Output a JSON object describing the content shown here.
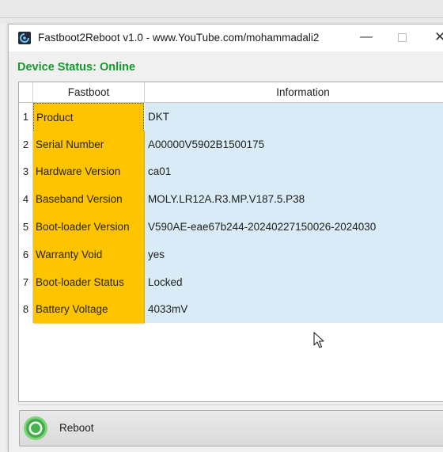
{
  "window": {
    "title": "Fastboot2Reboot v1.0 - www.YouTube.com/mohammadali2",
    "minimize_glyph": "—",
    "close_glyph": "✕"
  },
  "status": {
    "text": "Device Status: Online",
    "color": "#129a2a"
  },
  "table": {
    "columns": [
      "Fastboot",
      "Information"
    ],
    "rows": [
      {
        "num": "1",
        "key": "Product",
        "value": "DKT"
      },
      {
        "num": "2",
        "key": "Serial Number",
        "value": "A00000V5902B1500175"
      },
      {
        "num": "3",
        "key": "Hardware Version",
        "value": "ca01"
      },
      {
        "num": "4",
        "key": "Baseband Version",
        "value": "MOLY.LR12A.R3.MP.V187.5.P38"
      },
      {
        "num": "5",
        "key": "Boot-loader Version",
        "value": "V590AE-eae67b244-20240227150026-2024030"
      },
      {
        "num": "6",
        "key": "Warranty Void",
        "value": "yes"
      },
      {
        "num": "7",
        "key": "Boot-loader Status",
        "value": "Locked"
      },
      {
        "num": "8",
        "key": "Battery Voltage",
        "value": "4033mV"
      }
    ]
  },
  "buttons": {
    "reboot_label": "Reboot",
    "reboot_icon": "reboot-icon"
  },
  "colors": {
    "key_cell": "#fec400",
    "value_cell": "#d9ebf7",
    "accent_green": "#129a2a"
  }
}
